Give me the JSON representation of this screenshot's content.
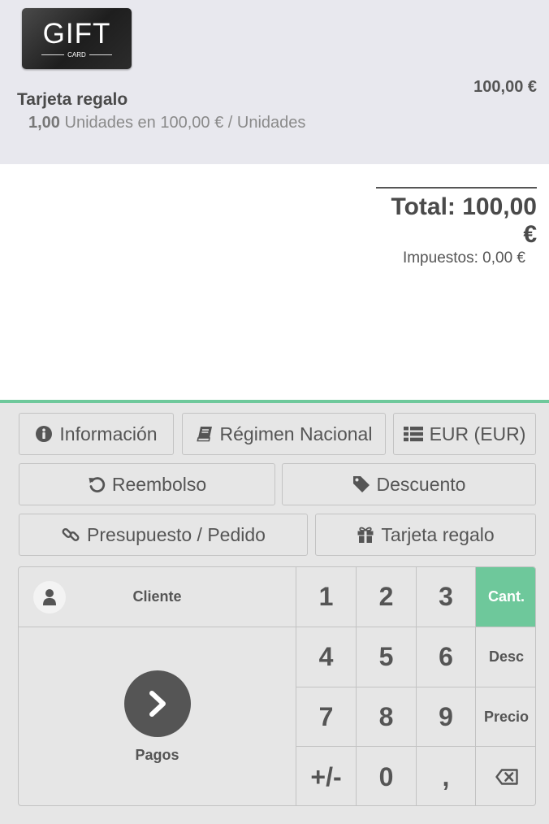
{
  "order": {
    "gift_image": {
      "big": "GIFT",
      "small": "CARD"
    },
    "line": {
      "product": "Tarjeta regalo",
      "price": "100,00 €",
      "quantity": "1,00",
      "unit_info": "Unidades en 100,00 € / Unidades"
    },
    "total": "Total: 100,00 €",
    "taxes": "Impuestos: 0,00 €"
  },
  "control_buttons": {
    "info": {
      "label": "Información",
      "icon": "info-circle-icon"
    },
    "fiscal_position": {
      "label": "Régimen Nacional",
      "icon": "book-icon"
    },
    "pricelist": {
      "label": "EUR (EUR)",
      "icon": "list-icon"
    },
    "refund": {
      "label": "Reembolso",
      "icon": "undo-icon"
    },
    "discount": {
      "label": "Descuento",
      "icon": "tag-icon"
    },
    "quotation": {
      "label": "Presupuesto / Pedido",
      "icon": "link-icon"
    },
    "gift_card": {
      "label": "Tarjeta regalo",
      "icon": "gift-icon"
    }
  },
  "actionpad": {
    "customer_label": "Cliente",
    "payment_label": "Pagos"
  },
  "numpad": {
    "keys": [
      "1",
      "2",
      "3",
      "4",
      "5",
      "6",
      "7",
      "8",
      "9",
      "+/-",
      "0",
      ","
    ],
    "modes": {
      "quantity": "Cant.",
      "discount": "Desc",
      "price": "Precio"
    },
    "active_mode": "Cant.",
    "backspace_icon": "backspace-icon"
  },
  "colors": {
    "accent": "#6ec89b",
    "orderline_bg": "#e8e8ee",
    "panel_bg": "#e6e6e6",
    "text": "#555555"
  }
}
